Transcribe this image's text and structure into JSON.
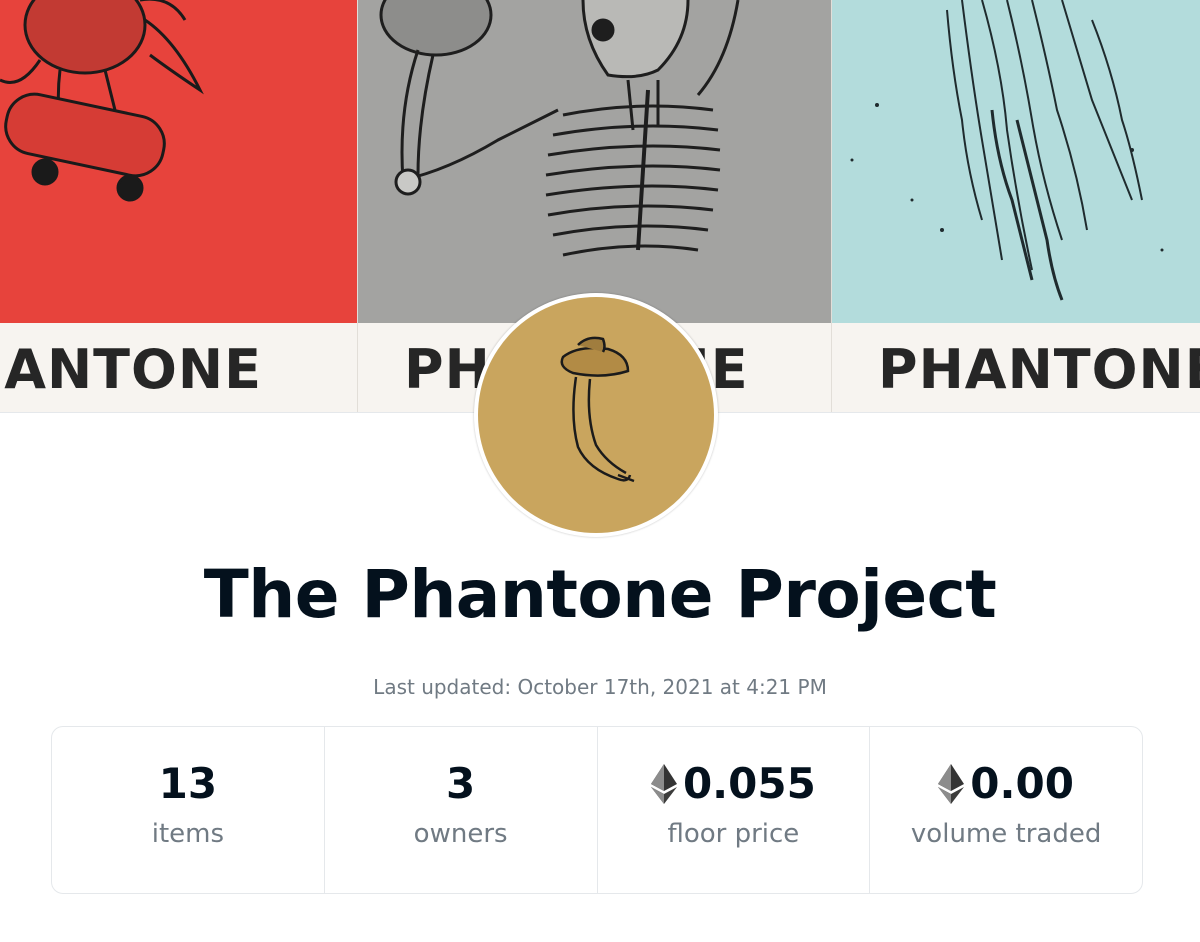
{
  "banner": {
    "panels": [
      {
        "label": "HANTONE",
        "color": "#e7433c"
      },
      {
        "label": "PHANTONE",
        "color": "#a3a3a1"
      },
      {
        "label": "PHANTONE",
        "color": "#b3dcdc"
      }
    ]
  },
  "avatar": {
    "icon": "banana-with-hat-icon",
    "color": "#c9a55e"
  },
  "collection": {
    "title": "The Phantone Project",
    "last_updated": "Last updated: October 17th, 2021 at 4:21 PM"
  },
  "stats": [
    {
      "value": "13",
      "label": "items",
      "currency": ""
    },
    {
      "value": "3",
      "label": "owners",
      "currency": ""
    },
    {
      "value": "0.055",
      "label": "floor price",
      "currency": "eth-icon"
    },
    {
      "value": "0.00",
      "label": "volume traded",
      "currency": "eth-icon"
    }
  ]
}
